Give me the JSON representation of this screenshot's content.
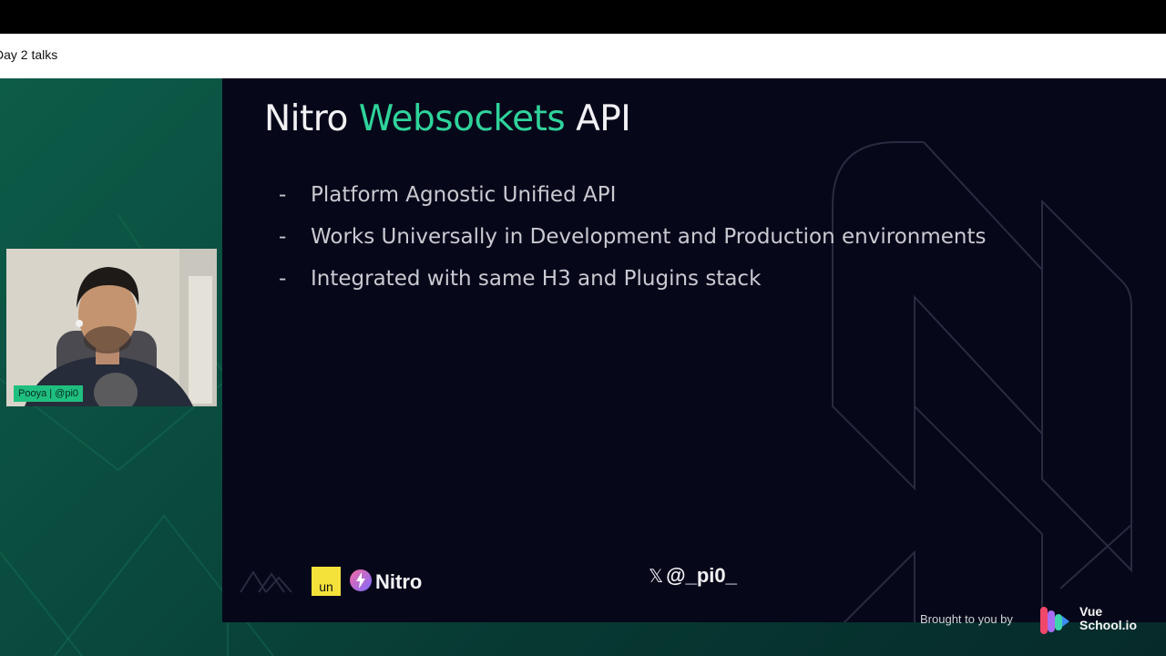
{
  "window": {
    "title": "Day 2 talks"
  },
  "slide": {
    "title_pre": "Nitro ",
    "title_accent": "Websockets",
    "title_post": " API",
    "bullets": [
      {
        "dash": "-",
        "text": "Platform Agnostic Unified API"
      },
      {
        "dash": "-",
        "text": "Works Universally in Development and Production environments"
      },
      {
        "dash": "-",
        "text": "Integrated with same H3 and Plugins stack"
      }
    ],
    "footer": {
      "un_label": "un",
      "nitro_label": "Nitro",
      "twitter_handle": "@_pi0_"
    }
  },
  "speaker": {
    "name_tag": "Pooya | @pi0"
  },
  "sponsor": {
    "brought_by": "Brought to you by",
    "brand_line1": "Vue",
    "brand_line2": "School.io"
  },
  "colors": {
    "accent": "#2fd39a",
    "slide_bg": "#07071a",
    "stage_green": "#0d5c48",
    "name_tag_bg": "#1fbf7f",
    "un_yellow": "#f4e23a"
  }
}
